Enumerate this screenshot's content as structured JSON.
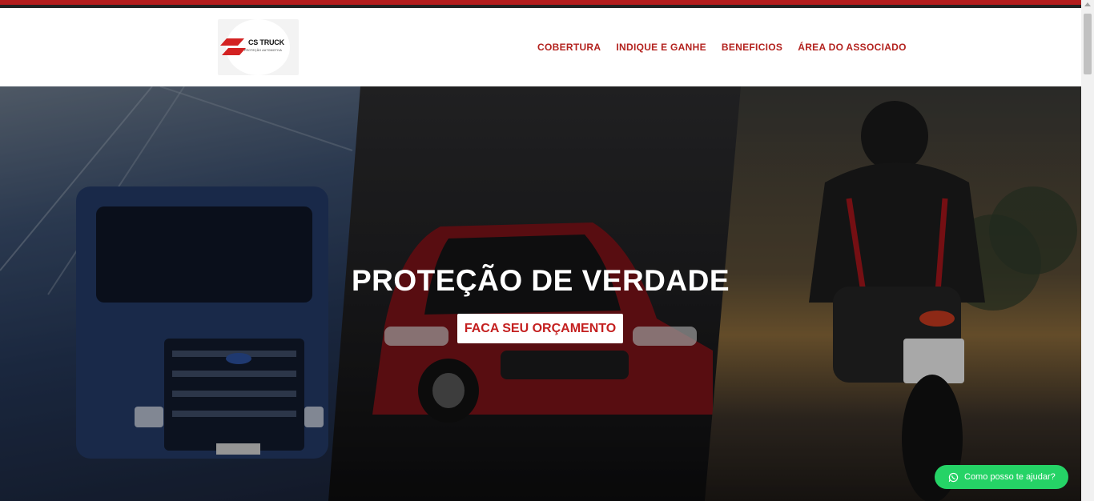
{
  "brand": {
    "logo_title": "CS TRUCK",
    "logo_subtitle": "PROTEÇÃO AUTOMOTIVA",
    "accent_color": "#b3221e"
  },
  "nav": {
    "items": [
      {
        "label": "COBERTURA"
      },
      {
        "label": "INDIQUE E GANHE"
      },
      {
        "label": "BENEFICIOS"
      },
      {
        "label": "ÁREA DO ASSOCIADO"
      }
    ]
  },
  "hero": {
    "title": "PROTEÇÃO DE VERDADE",
    "cta_label": "FACA SEU ORÇAMENTO",
    "cta_color": "#c41f1f",
    "panels": [
      "truck",
      "car",
      "motorcycle"
    ]
  },
  "chat": {
    "label": "Como posso te ajudar?",
    "icon": "whatsapp-icon",
    "color": "#25d366"
  }
}
